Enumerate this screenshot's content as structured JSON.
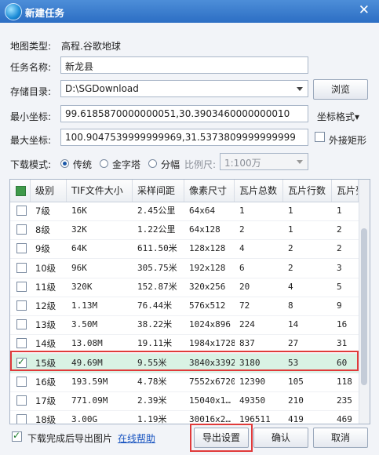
{
  "window": {
    "title": "新建任务",
    "close_glyph": "✕"
  },
  "map_type": {
    "label": "地图类型:",
    "value": "高程.谷歌地球"
  },
  "task_name": {
    "label": "任务名称:",
    "value": "新龙县"
  },
  "storage": {
    "label": "存储目录:",
    "value": "D:\\SGDownload",
    "browse": "浏览"
  },
  "min_coord": {
    "label": "最小坐标:",
    "value": "99.6185870000000051,30.3903460000000010",
    "format": "坐标格式▾"
  },
  "max_coord": {
    "label": "最大坐标:",
    "value": "100.9047539999999969,31.5373809999999999",
    "outer_rect": "外接矩形"
  },
  "download_mode": {
    "label": "下载模式:",
    "opt1": "传统",
    "opt2": "金字塔",
    "opt3": "分幅",
    "scale_label": "比例尺:",
    "scale_value": "1:100万"
  },
  "table": {
    "columns": [
      "级别",
      "TIF文件大小",
      "采样间距",
      "像素尺寸",
      "瓦片总数",
      "瓦片行数",
      "瓦片列"
    ],
    "rows": [
      {
        "checked": false,
        "level": "7级",
        "size": "16K",
        "spacing": "2.45公里",
        "pixels": "64x64",
        "tiles": "1",
        "rows": "1",
        "cols": "1"
      },
      {
        "checked": false,
        "level": "8级",
        "size": "32K",
        "spacing": "1.22公里",
        "pixels": "64x128",
        "tiles": "2",
        "rows": "1",
        "cols": "2"
      },
      {
        "checked": false,
        "level": "9级",
        "size": "64K",
        "spacing": "611.50米",
        "pixels": "128x128",
        "tiles": "4",
        "rows": "2",
        "cols": "2"
      },
      {
        "checked": false,
        "level": "10级",
        "size": "96K",
        "spacing": "305.75米",
        "pixels": "192x128",
        "tiles": "6",
        "rows": "2",
        "cols": "3"
      },
      {
        "checked": false,
        "level": "11级",
        "size": "320K",
        "spacing": "152.87米",
        "pixels": "320x256",
        "tiles": "20",
        "rows": "4",
        "cols": "5"
      },
      {
        "checked": false,
        "level": "12级",
        "size": "1.13M",
        "spacing": "76.44米",
        "pixels": "576x512",
        "tiles": "72",
        "rows": "8",
        "cols": "9"
      },
      {
        "checked": false,
        "level": "13级",
        "size": "3.50M",
        "spacing": "38.22米",
        "pixels": "1024x896",
        "tiles": "224",
        "rows": "14",
        "cols": "16"
      },
      {
        "checked": false,
        "level": "14级",
        "size": "13.08M",
        "spacing": "19.11米",
        "pixels": "1984x1728",
        "tiles": "837",
        "rows": "27",
        "cols": "31"
      },
      {
        "checked": true,
        "level": "15级",
        "size": "49.69M",
        "spacing": "9.55米",
        "pixels": "3840x3392",
        "tiles": "3180",
        "rows": "53",
        "cols": "60"
      },
      {
        "checked": false,
        "level": "16级",
        "size": "193.59M",
        "spacing": "4.78米",
        "pixels": "7552x6720",
        "tiles": "12390",
        "rows": "105",
        "cols": "118"
      },
      {
        "checked": false,
        "level": "17级",
        "size": "771.09M",
        "spacing": "2.39米",
        "pixels": "15040x1…",
        "tiles": "49350",
        "rows": "210",
        "cols": "235"
      },
      {
        "checked": false,
        "level": "18级",
        "size": "3.00G",
        "spacing": "1.19米",
        "pixels": "30016x2…",
        "tiles": "196511",
        "rows": "419",
        "cols": "469"
      }
    ]
  },
  "footer": {
    "export_after": "下载完成后导出图片",
    "help": "在线帮助",
    "export_settings": "导出设置",
    "ok": "确认",
    "cancel": "取消"
  }
}
